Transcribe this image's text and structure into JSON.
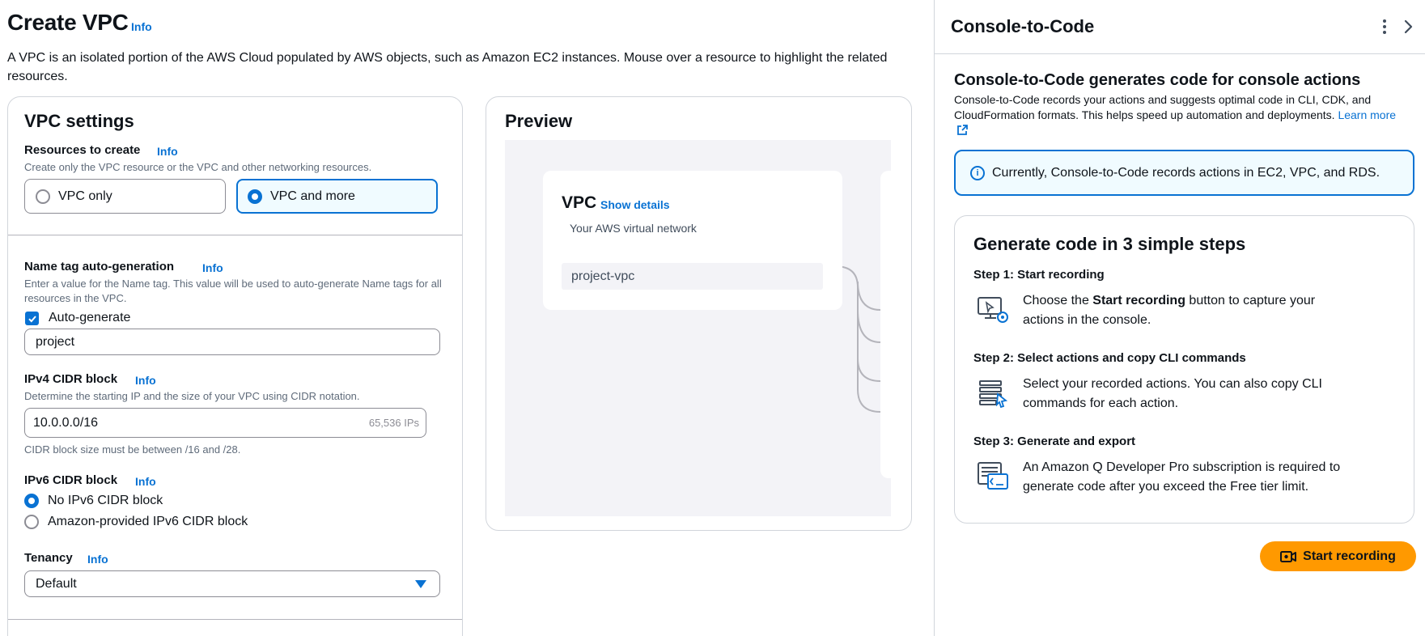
{
  "page": {
    "title": "Create VPC",
    "title_info": "Info",
    "description": "A VPC is an isolated portion of the AWS Cloud populated by AWS objects, such as Amazon EC2 instances. Mouse over a resource to highlight the related resources."
  },
  "settings": {
    "title": "VPC settings",
    "resources": {
      "label": "Resources to create",
      "info": "Info",
      "description": "Create only the VPC resource or the VPC and other networking resources.",
      "options": [
        "VPC only",
        "VPC and more"
      ],
      "selected": "VPC and more"
    },
    "name_tag": {
      "label": "Name tag auto-generation",
      "info": "Info",
      "description": "Enter a value for the Name tag. This value will be used to auto-generate Name tags for all resources in the VPC.",
      "checkbox_label": "Auto-generate",
      "checked": true,
      "value": "project"
    },
    "ipv4": {
      "label": "IPv4 CIDR block",
      "info": "Info",
      "description": "Determine the starting IP and the size of your VPC using CIDR notation.",
      "value": "10.0.0.0/16",
      "suffix": "65,536 IPs",
      "constraint": "CIDR block size must be between /16 and /28."
    },
    "ipv6": {
      "label": "IPv6 CIDR block",
      "info": "Info",
      "options": [
        "No IPv6 CIDR block",
        "Amazon-provided IPv6 CIDR block"
      ],
      "selected": "No IPv6 CIDR block"
    },
    "tenancy": {
      "label": "Tenancy",
      "info": "Info",
      "value": "Default"
    }
  },
  "preview": {
    "title": "Preview",
    "vpc_title": "VPC",
    "show_details": "Show details",
    "vpc_subtitle": "Your AWS virtual network",
    "vpc_name": "project-vpc"
  },
  "panel": {
    "title": "Console-to-Code",
    "heading": "Console-to-Code generates code for console actions",
    "description": "Console-to-Code records your actions and suggests optimal code in CLI, CDK, and CloudFormation formats. This helps speed up automation and deployments.",
    "learn_more": "Learn more",
    "alert": "Currently, Console-to-Code records actions in EC2, VPC, and RDS.",
    "steps_title": "Generate code in 3 simple steps",
    "steps": [
      {
        "label": "Step 1: Start recording",
        "text_pre": "Choose the ",
        "text_bold": "Start recording",
        "text_post": " button to capture your actions in the console.",
        "icon": "screen-recording-icon"
      },
      {
        "label": "Step 2: Select actions and copy CLI commands",
        "text": "Select your recorded actions. You can also copy CLI commands for each action.",
        "icon": "list-select-icon"
      },
      {
        "label": "Step 3: Generate and export",
        "text": "An Amazon Q Developer Pro subscription is required to generate code after you exceed the Free tier limit.",
        "icon": "terminal-code-icon"
      }
    ],
    "record_button": "Start recording"
  },
  "colors": {
    "accent": "#0972d3",
    "record": "#ff9900",
    "border": "#d1d5db"
  }
}
